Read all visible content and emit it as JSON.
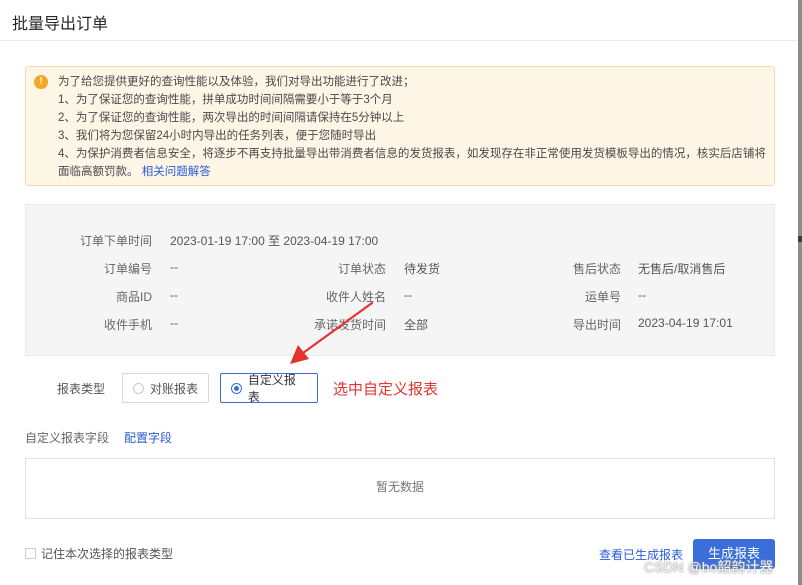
{
  "dialog": {
    "title": "批量导出订单"
  },
  "notice": {
    "lines": [
      "为了给您提供更好的查询性能以及体验，我们对导出功能进行了改进；",
      "1、为了保证您的查询性能，拼单成功时间间隔需要小于等于3个月",
      "2、为了保证您的查询性能，两次导出的时间间隔请保持在5分钟以上",
      "3、我们将为您保留24小时内导出的任务列表，便于您随时导出",
      "4、为保护消费者信息安全，将逐步不再支持批量导出带消费者信息的发货报表，如发现存在非正常使用发货模板导出的情况，核实后店铺将面临高额罚款。"
    ],
    "link_text": "相关问题解答"
  },
  "filters": {
    "order_time": {
      "label": "订单下单时间",
      "value": "2023-01-19 17:00 至 2023-04-19 17:00"
    },
    "order_no": {
      "label": "订单编号",
      "value": "--"
    },
    "order_status": {
      "label": "订单状态",
      "value": "待发货"
    },
    "after_sale_status": {
      "label": "售后状态",
      "value": "无售后/取消售后"
    },
    "goods_id": {
      "label": "商品ID",
      "value": "--"
    },
    "receiver_name": {
      "label": "收件人姓名",
      "value": "--"
    },
    "waybill_no": {
      "label": "运单号",
      "value": "--"
    },
    "receiver_phone": {
      "label": "收件手机",
      "value": "--"
    },
    "promise_ship_time": {
      "label": "承诺发货时间",
      "value": "全部"
    },
    "export_time": {
      "label": "导出时间",
      "value": "2023-04-19 17:01"
    }
  },
  "report_type": {
    "label": "报表类型",
    "options": [
      {
        "label": "对账报表",
        "selected": false
      },
      {
        "label": "自定义报表",
        "selected": true
      }
    ]
  },
  "annotation": {
    "text": "选中自定义报表",
    "color": "#e4332f"
  },
  "custom_fields": {
    "label": "自定义报表字段",
    "link": "配置字段",
    "empty_text": "暂无数据"
  },
  "footer": {
    "remember_label": "记住本次选择的报表类型",
    "view_link": "查看已生成报表",
    "generate_button": "生成报表"
  },
  "watermark": "CSDN @bo韶韵计器",
  "colors": {
    "primary": "#3a6fdb",
    "link": "#2b5bd7",
    "warning_bg": "#fdf6e6",
    "warning_icon": "#f5a623"
  }
}
